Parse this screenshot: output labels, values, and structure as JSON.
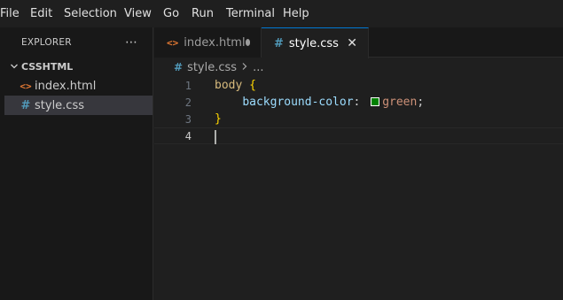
{
  "menu": [
    "File",
    "Edit",
    "Selection",
    "View",
    "Go",
    "Run",
    "Terminal",
    "Help"
  ],
  "explorer": {
    "title": "EXPLORER",
    "folder": "CSSHTML",
    "files": [
      {
        "name": "index.html",
        "icon": "html-file-icon",
        "selected": false
      },
      {
        "name": "style.css",
        "icon": "css-file-icon",
        "selected": true
      }
    ]
  },
  "tabs": [
    {
      "label": "index.html",
      "icon": "html-file-icon",
      "active": false,
      "modified": true
    },
    {
      "label": "style.css",
      "icon": "css-file-icon",
      "active": true,
      "modified": false
    }
  ],
  "breadcrumb": {
    "file": "style.css",
    "rest": "..."
  },
  "editor": {
    "line_numbers": [
      "1",
      "2",
      "3",
      "4"
    ],
    "selector": "body",
    "open_brace": "{",
    "property": "background-color",
    "colon": ":",
    "value": "green",
    "semicolon": ";",
    "close_brace": "}",
    "swatch_color": "#008000"
  },
  "colors": {
    "accent": "#0078d4",
    "html_icon": "#e37933",
    "css_icon": "#519aba"
  }
}
